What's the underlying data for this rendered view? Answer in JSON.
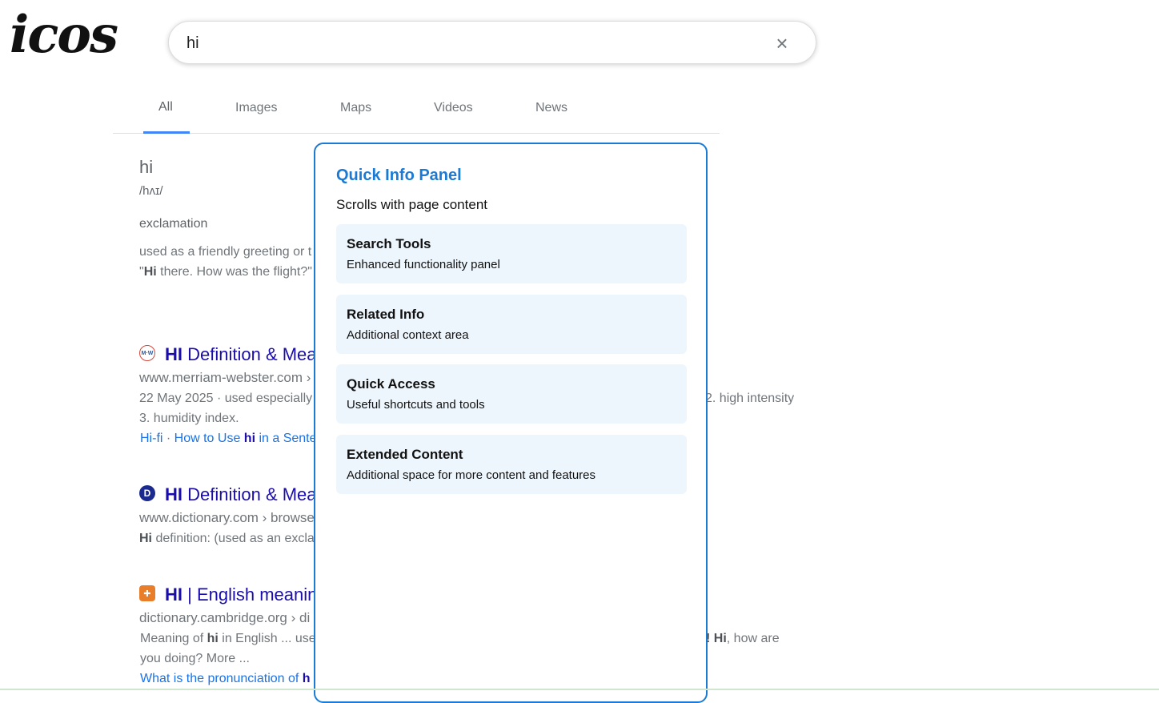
{
  "logo": "icos",
  "search": {
    "value": "hi",
    "clear": "×"
  },
  "tabs": [
    {
      "label": "All",
      "active": true
    },
    {
      "label": "Images"
    },
    {
      "label": "Maps"
    },
    {
      "label": "Videos"
    },
    {
      "label": "News"
    }
  ],
  "dictionary": {
    "word": "hi",
    "phonetic": "/hʌɪ/",
    "pos": "exclamation",
    "definition": "used as a friendly greeting or t",
    "example_pre": "\"",
    "example_bold": "Hi",
    "example_post": " there. How was the flight?\""
  },
  "results": [
    {
      "favicon": "M·W",
      "title_bold": "HI",
      "title_rest": " Definition & Mea",
      "url": "www.merriam-webster.com ›",
      "snippet1_left": "22 May 2025 · used especially",
      "snippet1_right": "2. high intensity",
      "snippet2": "3. humidity index.",
      "links_a": "Hi-fi",
      "links_sep": " · ",
      "links_b_pre": "How to Use ",
      "links_b_bold": "hi",
      "links_b_post": " in a Sente"
    },
    {
      "favicon": "D",
      "title_bold": "HI",
      "title_rest": " Definition & Mea",
      "url": "www.dictionary.com › browse",
      "snippet_bold": "Hi",
      "snippet_rest": " definition: (used as an excla"
    },
    {
      "favicon": "✚",
      "title_bold": "HI",
      "title_rest": " | English meanin",
      "url": "dictionary.cambridge.org › di",
      "snippet1_left_pre": "Meaning of ",
      "snippet1_left_bold": "hi",
      "snippet1_left_post": " in English ... use",
      "snippet1_right_pre": "! ",
      "snippet1_right_bold": "Hi",
      "snippet1_right_post": ", how are",
      "snippet2": "you doing? More ...",
      "link_pre": "What is the pronunciation of ",
      "link_bold": "h"
    }
  ],
  "panel": {
    "title": "Quick Info Panel",
    "subtitle": "Scrolls with page content",
    "cards": [
      {
        "title": "Search Tools",
        "desc": "Enhanced functionality panel"
      },
      {
        "title": "Related Info",
        "desc": "Additional context area"
      },
      {
        "title": "Quick Access",
        "desc": "Useful shortcuts and tools"
      },
      {
        "title": "Extended Content",
        "desc": "Additional space for more content and features"
      }
    ]
  },
  "colors": {
    "accent": "#1a7ad4",
    "link": "#1a0dab",
    "tab_indicator": "#4285f4"
  }
}
